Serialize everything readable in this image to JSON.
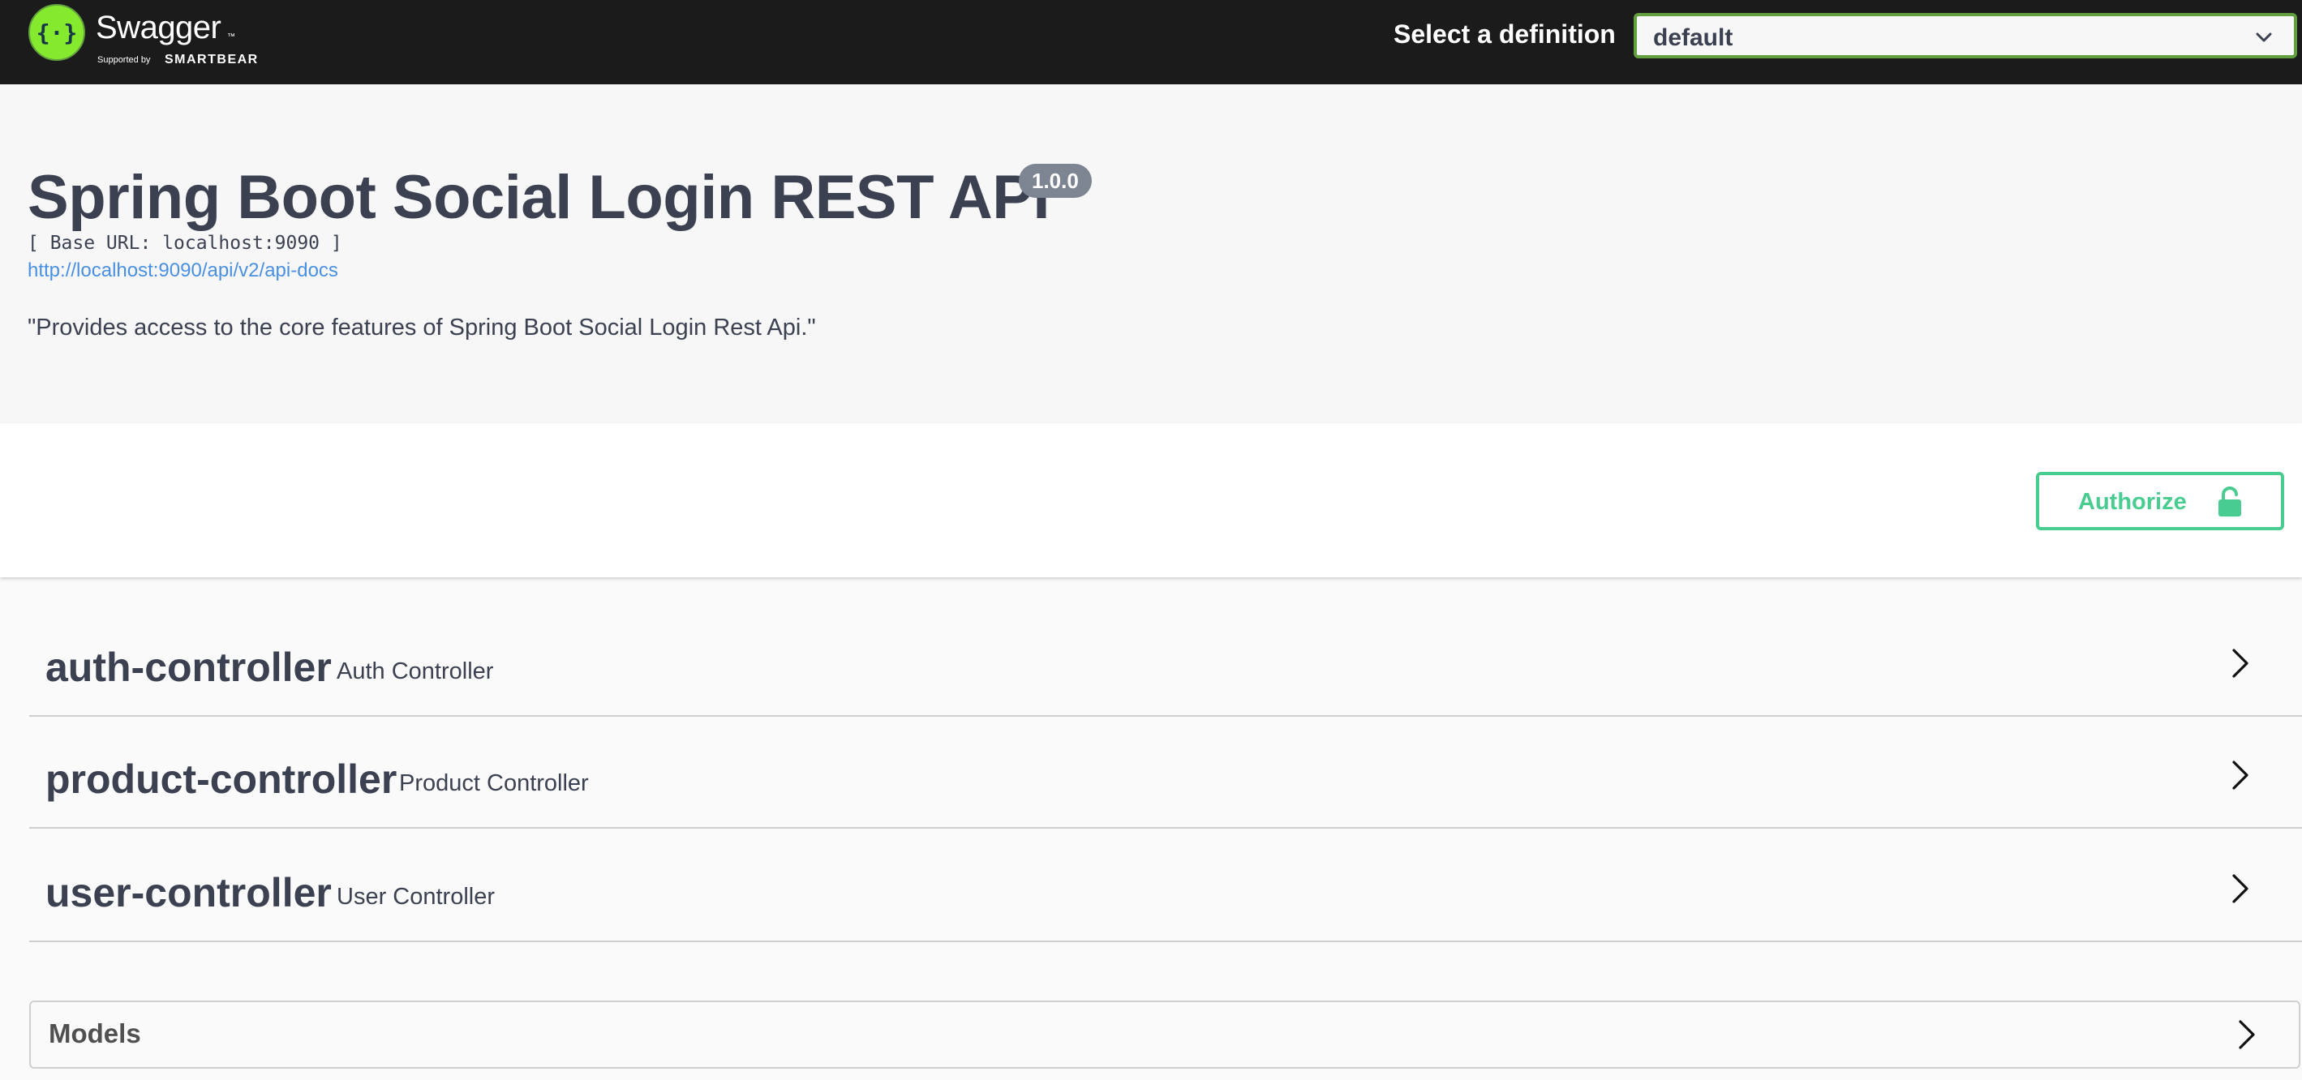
{
  "topbar": {
    "brand_name": "Swagger",
    "brand_tm": "™",
    "supported_by": "Supported by",
    "brand_company": "SMARTBEAR",
    "definition_label": "Select a definition",
    "definition_selected": "default",
    "logo_icon": "swagger-logo-icon",
    "accent_color": "#62a03f"
  },
  "info": {
    "title": "Spring Boot Social Login REST API",
    "version": "1.0.0",
    "base_url": "[ Base URL: localhost:9090 ]",
    "docs_url": "http://localhost:9090/api/v2/api-docs",
    "description": "\"Provides access to the core features of Spring Boot Social Login Rest Api.\""
  },
  "scheme": {
    "authorize_label": "Authorize",
    "authorize_icon": "unlocked-padlock-icon",
    "authorize_color": "#49cc90"
  },
  "tags": [
    {
      "name": "auth-controller",
      "description": "Auth Controller"
    },
    {
      "name": "product-controller",
      "description": "Product Controller"
    },
    {
      "name": "user-controller",
      "description": "User Controller"
    }
  ],
  "models": {
    "title": "Models",
    "icon": "chevron-right-icon"
  },
  "colors": {
    "topbar_bg": "#1b1b1b",
    "text": "#3b4151",
    "link": "#4990e2",
    "version_badge": "#7d8492"
  }
}
